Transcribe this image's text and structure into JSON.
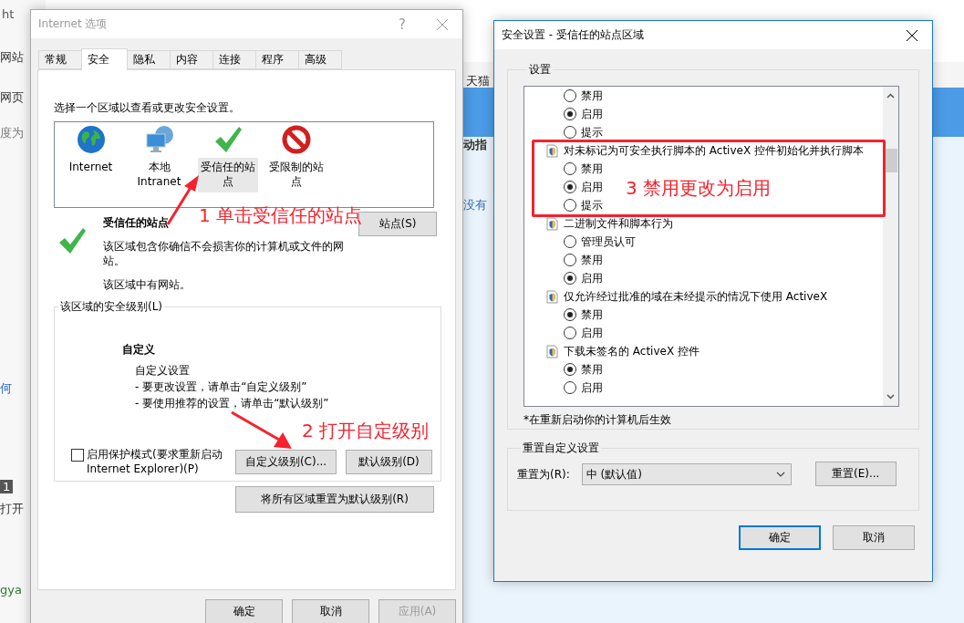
{
  "background": {
    "fragments": [
      "ht",
      "网站",
      "网页",
      "度为",
      "何",
      "1",
      "打开",
      "gya",
      "天猫",
      "动指",
      "没有"
    ]
  },
  "internet_options": {
    "title": "Internet 选项",
    "help": "?",
    "tabs": [
      {
        "label": "常规",
        "selected": false
      },
      {
        "label": "安全",
        "selected": true
      },
      {
        "label": "隐私",
        "selected": false
      },
      {
        "label": "内容",
        "selected": false
      },
      {
        "label": "连接",
        "selected": false
      },
      {
        "label": "程序",
        "selected": false
      },
      {
        "label": "高级",
        "selected": false
      }
    ],
    "intro": "选择一个区域以查看或更改安全设置。",
    "zones": [
      {
        "kind": "globe",
        "label": "Internet",
        "selected": false
      },
      {
        "kind": "computer",
        "label": "本地 Intranet",
        "selected": false
      },
      {
        "kind": "check",
        "label": "受信任的站点",
        "selected": true
      },
      {
        "kind": "blocked",
        "label": "受限制的站点",
        "selected": false
      }
    ],
    "zone_title": "受信任的站点",
    "zone_description": "该区域包含你确信不会损害你的计算机或文件的网站。",
    "zone_note": "该区域中有网站。",
    "sites_button": "站点(S)",
    "level_group": {
      "title": "该区域的安全级别(L)",
      "level_name": "自定义",
      "details": [
        "自定义设置",
        "- 要更改设置，请单击“自定义级别”",
        "- 要使用推荐的设置，请单击“默认级别”"
      ],
      "protected_mode": {
        "label": "启用保护模式(要求重新启动 Internet Explorer)(P)",
        "checked": false
      },
      "buttons": [
        "自定义级别(C)...",
        "默认级别(D)"
      ]
    },
    "reset_all_button": "将所有区域重置为默认级别(R)",
    "footer_buttons": [
      {
        "label": "确定",
        "disabled": false
      },
      {
        "label": "取消",
        "disabled": false
      },
      {
        "label": "应用(A)",
        "disabled": true
      }
    ]
  },
  "security_settings": {
    "title": "安全设置 - 受信任的站点区域",
    "settings_group": {
      "title": "设置",
      "items": [
        {
          "kind": "radio",
          "label": "禁用",
          "selected": false
        },
        {
          "kind": "radio",
          "label": "启用",
          "selected": true
        },
        {
          "kind": "radio",
          "label": "提示",
          "selected": false
        },
        {
          "kind": "header",
          "label": "对未标记为可安全执行脚本的 ActiveX 控件初始化并执行脚本"
        },
        {
          "kind": "radio",
          "label": "禁用",
          "selected": false
        },
        {
          "kind": "radio",
          "label": "启用",
          "selected": true
        },
        {
          "kind": "radio",
          "label": "提示",
          "selected": false
        },
        {
          "kind": "header",
          "label": "二进制文件和脚本行为"
        },
        {
          "kind": "radio",
          "label": "管理员认可",
          "selected": false
        },
        {
          "kind": "radio",
          "label": "禁用",
          "selected": false
        },
        {
          "kind": "radio",
          "label": "启用",
          "selected": true
        },
        {
          "kind": "header",
          "label": "仅允许经过批准的域在未经提示的情况下使用 ActiveX"
        },
        {
          "kind": "radio",
          "label": "禁用",
          "selected": true
        },
        {
          "kind": "radio",
          "label": "启用",
          "selected": false
        },
        {
          "kind": "header",
          "label": "下载未签名的 ActiveX 控件"
        },
        {
          "kind": "radio",
          "label": "禁用",
          "selected": true
        },
        {
          "kind": "radio",
          "label": "启用",
          "selected": false
        }
      ]
    },
    "footnote": "*在重新启动你的计算机后生效",
    "reset_group": {
      "title": "重置自定义设置",
      "label": "重置为(R):",
      "value": "中 (默认值)",
      "button": "重置(E)..."
    },
    "footer_buttons": [
      {
        "label": "确定",
        "focused": true
      },
      {
        "label": "取消",
        "focused": false
      }
    ]
  },
  "annotations": [
    {
      "kind": "step",
      "text": "1 单击受信任的站点"
    },
    {
      "kind": "step",
      "text": "2 打开自定级别"
    },
    {
      "kind": "step",
      "text": "3 禁用更改为启用"
    }
  ]
}
